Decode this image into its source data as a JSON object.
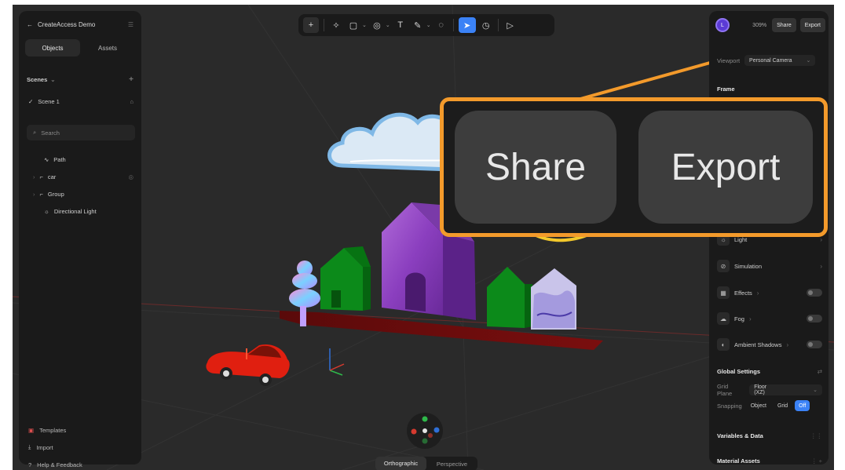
{
  "left_panel": {
    "project_title": "CreateAccess Demo",
    "tabs": [
      {
        "label": "Objects"
      },
      {
        "label": "Assets"
      }
    ],
    "scenes_label": "Scenes",
    "scene_name": "Scene 1",
    "search_placeholder": "Search",
    "layers": [
      {
        "label": "Path",
        "icon": "path-icon"
      },
      {
        "label": "car",
        "icon": "group-icon"
      },
      {
        "label": "Group",
        "icon": "group-icon"
      },
      {
        "label": "Directional Light",
        "icon": "light-icon"
      }
    ],
    "footer": [
      {
        "label": "Templates",
        "icon": "templates-icon"
      },
      {
        "label": "Import",
        "icon": "import-icon"
      },
      {
        "label": "Help & Feedback",
        "icon": "help-icon"
      }
    ]
  },
  "toolbar": {
    "tools": [
      "add-icon",
      "pen-tool-icon",
      "shape-icon",
      "sphere-icon",
      "text-icon",
      "paint-icon",
      "comment-icon",
      "pointer-icon",
      "timer-icon",
      "play-icon"
    ],
    "accent": "#3b82f6"
  },
  "right_panel": {
    "avatar_initial": "L",
    "zoom": "309%",
    "share_label": "Share",
    "export_label": "Export",
    "viewport_label": "Viewport",
    "viewport_value": "Personal Camera",
    "frame_label": "Frame",
    "light_label": "Light",
    "simulation_label": "Simulation",
    "effects_label": "Effects",
    "fog_label": "Fog",
    "ambient_shadows_label": "Ambient Shadows",
    "global_settings_label": "Global Settings",
    "grid_plane_label": "Grid Plane",
    "grid_plane_value": "Floor (XZ)",
    "snapping_label": "Snapping",
    "snapping_options": [
      "Object",
      "Grid",
      "Off"
    ],
    "snapping_selected": "Off",
    "variables_label": "Variables & Data",
    "material_assets_label": "Material Assets"
  },
  "callout": {
    "share_label": "Share",
    "export_label": "Export",
    "border_color": "#f39a2b"
  },
  "view_switch": {
    "orthographic": "Orthographic",
    "perspective": "Perspective",
    "selected": "Orthographic"
  }
}
